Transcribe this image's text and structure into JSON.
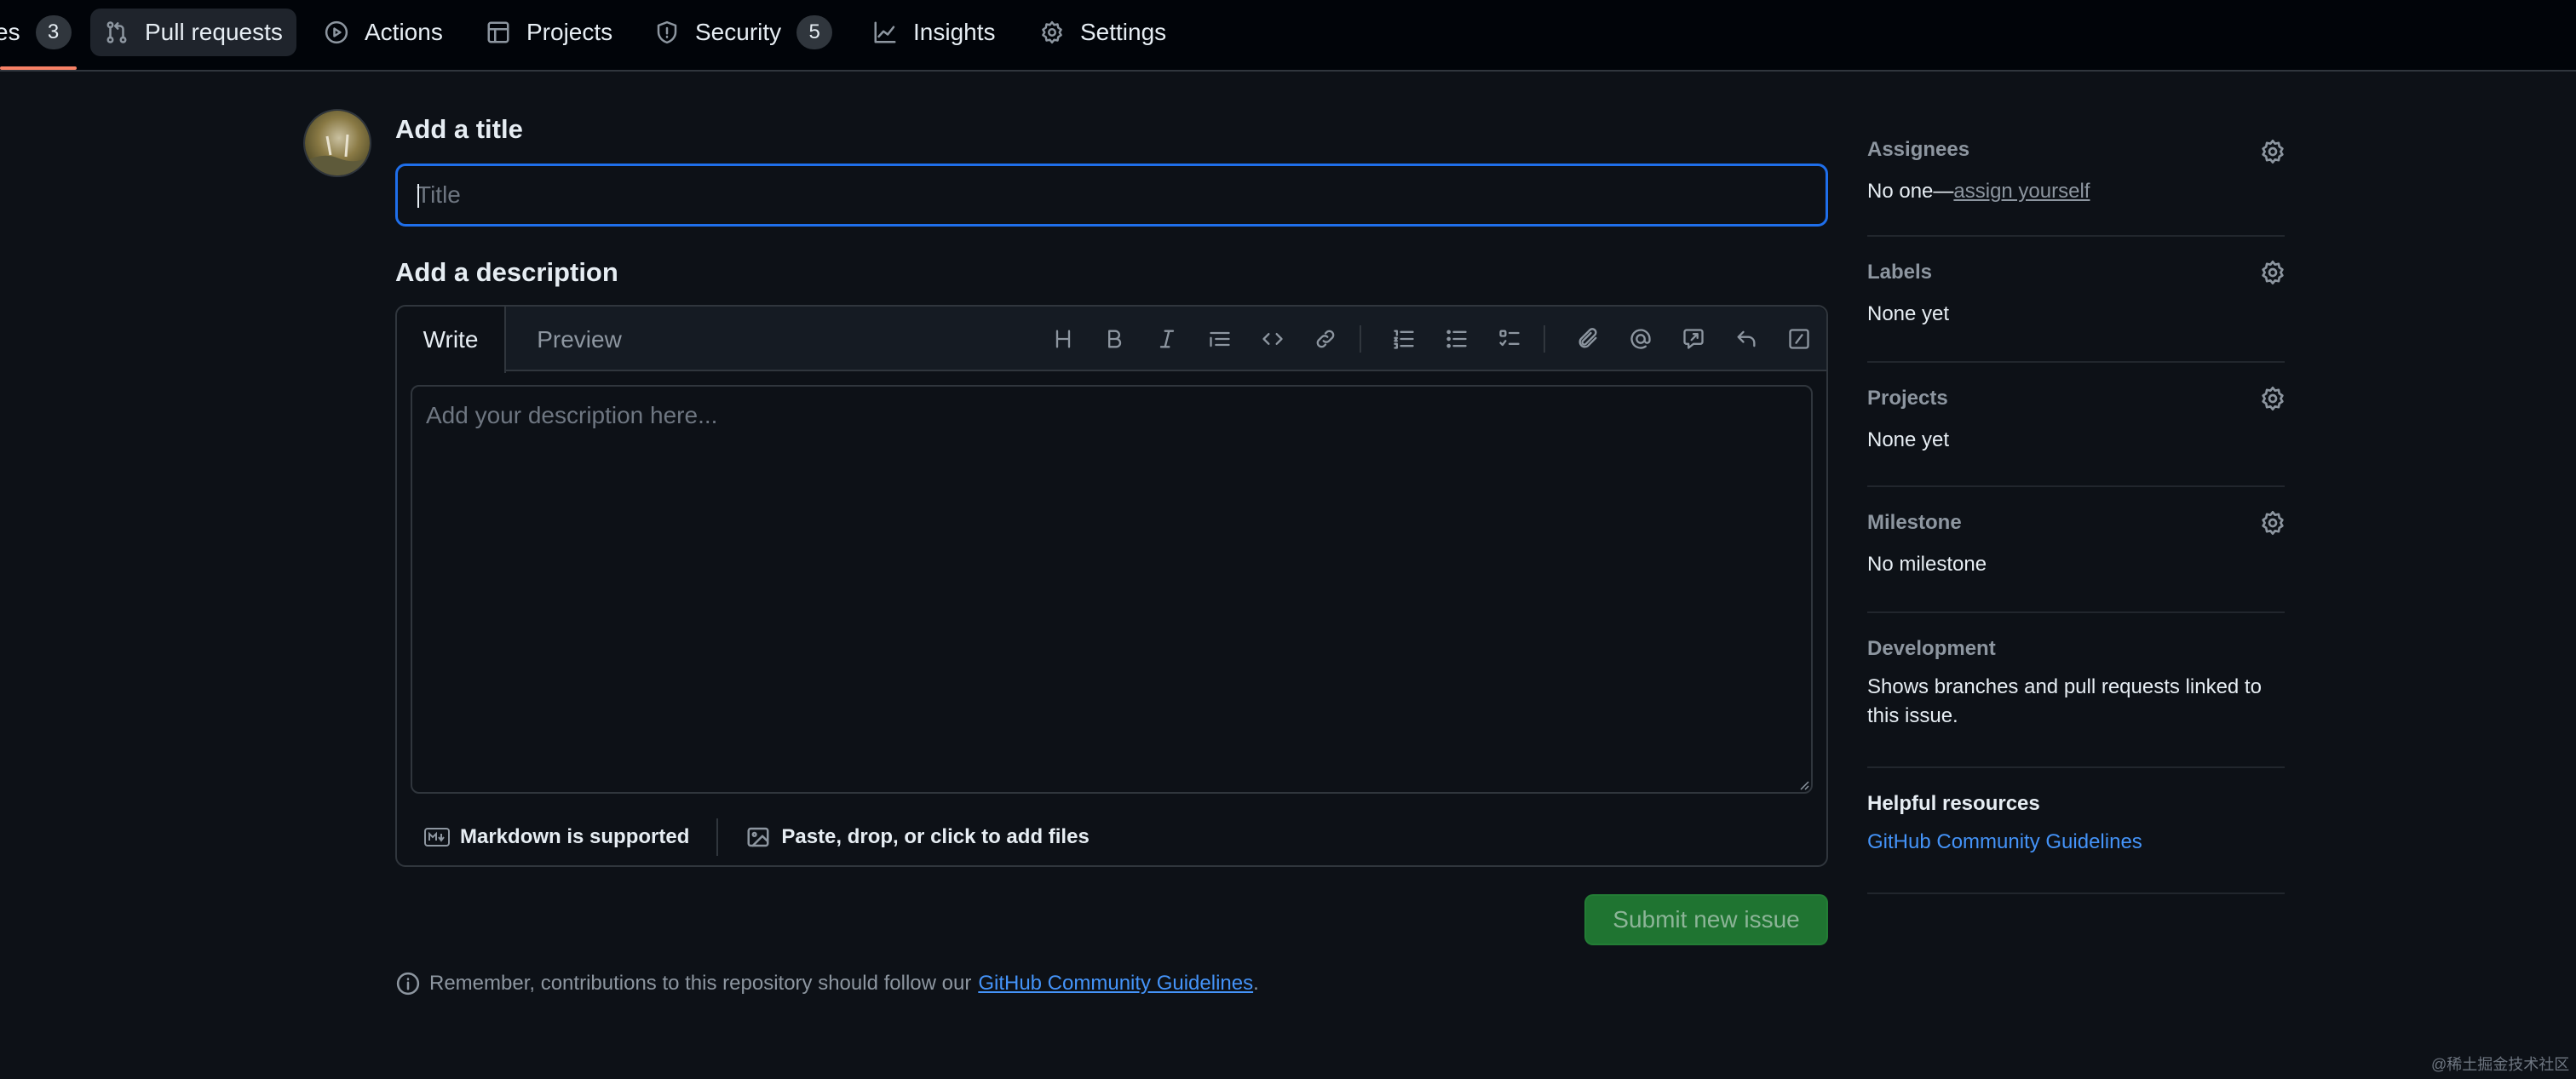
{
  "nav": {
    "issues_label_partial": "es",
    "issues_count": "3",
    "tabs": [
      {
        "label": "Pull requests"
      },
      {
        "label": "Actions"
      },
      {
        "label": "Projects"
      },
      {
        "label": "Security",
        "count": "5"
      },
      {
        "label": "Insights"
      },
      {
        "label": "Settings"
      }
    ]
  },
  "form": {
    "title_heading": "Add a title",
    "title_placeholder": "Title",
    "description_heading": "Add a description",
    "tab_write": "Write",
    "tab_preview": "Preview",
    "toolbar_icons": [
      "heading-icon",
      "bold-icon",
      "italic-icon",
      "quote-icon",
      "code-icon",
      "link-icon",
      "numbered-list-icon",
      "unordered-list-icon",
      "task-list-icon",
      "attach-icon",
      "mention-icon",
      "reference-icon",
      "undo-icon",
      "slash-commands-icon"
    ],
    "description_placeholder": "Add your description here...",
    "markdown_note": "Markdown is supported",
    "files_note": "Paste, drop, or click to add files",
    "submit_label": "Submit new issue",
    "reminder_prefix": "Remember, contributions to this repository should follow our",
    "reminder_link": "GitHub Community Guidelines",
    "reminder_suffix": "."
  },
  "sidebar": {
    "assignees": {
      "title": "Assignees",
      "value_prefix": "No one—",
      "value_link": "assign yourself"
    },
    "labels": {
      "title": "Labels",
      "value": "None yet"
    },
    "projects": {
      "title": "Projects",
      "value": "None yet"
    },
    "milestone": {
      "title": "Milestone",
      "value": "No milestone"
    },
    "development": {
      "title": "Development",
      "value_line1": "Shows branches and pull requests linked to",
      "value_line2": "this issue."
    },
    "helpful": {
      "title": "Helpful resources",
      "link": "GitHub Community Guidelines"
    }
  },
  "watermark": "@稀土掘金技术社区",
  "colors": {
    "accent": "#1f6feb",
    "submit": "#238636",
    "underline": "#f78166",
    "link": "#4493f8"
  }
}
